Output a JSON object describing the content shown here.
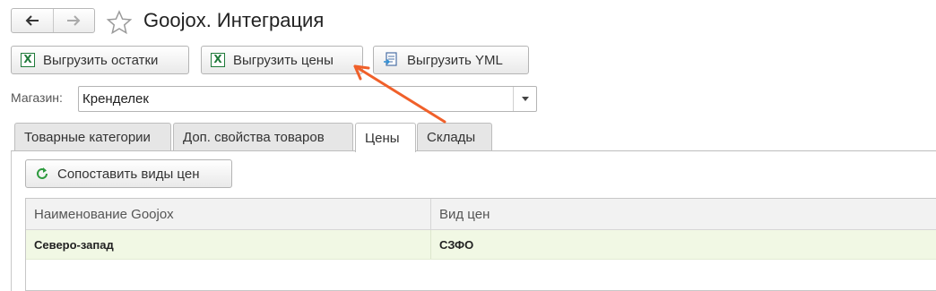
{
  "window": {
    "title": "Goojox. Интеграция",
    "nav": {
      "back_icon": "arrow-left-icon",
      "forward_icon": "arrow-right-icon"
    },
    "favorite_icon": "star-icon"
  },
  "toolbar": {
    "export_stock_label": "Выгрузить остатки",
    "export_prices_label": "Выгрузить цены",
    "export_yml_label": "Выгрузить YML"
  },
  "shop": {
    "label": "Магазин:",
    "value": "Кренделек"
  },
  "tabs": [
    {
      "label": "Товарные категории",
      "active": false
    },
    {
      "label": "Доп. свойства товаров",
      "active": false
    },
    {
      "label": "Цены",
      "active": true
    },
    {
      "label": "Склады",
      "active": false
    }
  ],
  "prices_panel": {
    "match_button_label": "Сопоставить виды цен",
    "table": {
      "columns": [
        "Наименование Goojox",
        "Вид цен"
      ],
      "rows": [
        [
          "Северо-запад",
          "СЗФО"
        ]
      ]
    }
  },
  "colors": {
    "annotation_arrow": "#f0602a",
    "excel_green": "#1f7a3a",
    "selected_row": "#f1f8e4"
  }
}
